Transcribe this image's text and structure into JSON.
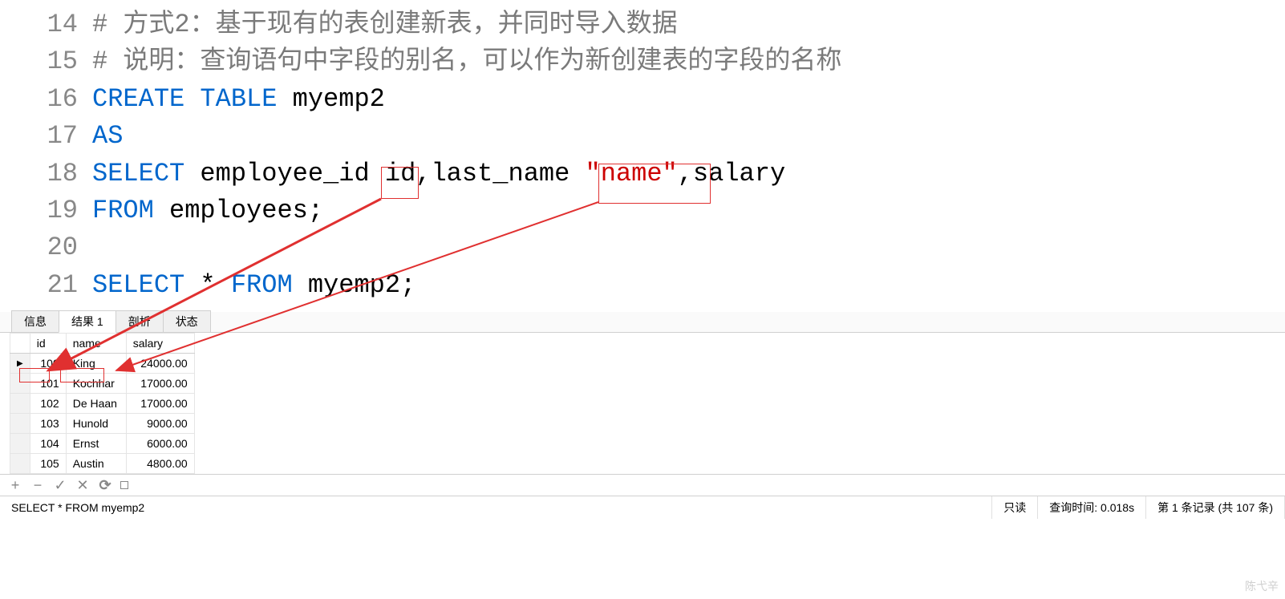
{
  "code": {
    "lines": [
      {
        "n": 14,
        "tokens": [
          {
            "t": "# 方式2：基于现有的表创建新表，并同时导入数据",
            "c": "cmt"
          }
        ]
      },
      {
        "n": 15,
        "tokens": [
          {
            "t": "# 说明：查询语句中字段的别名，可以作为新创建表的字段的名称",
            "c": "cmt"
          }
        ]
      },
      {
        "n": 16,
        "tokens": [
          {
            "t": "CREATE",
            "c": "kw"
          },
          {
            "t": " "
          },
          {
            "t": "TABLE",
            "c": "kw"
          },
          {
            "t": " myemp2"
          }
        ]
      },
      {
        "n": 17,
        "tokens": [
          {
            "t": "AS",
            "c": "kw"
          }
        ]
      },
      {
        "n": 18,
        "tokens": [
          {
            "t": "SELECT",
            "c": "kw"
          },
          {
            "t": " employee_id id,last_name "
          },
          {
            "t": "\"name\"",
            "c": "str"
          },
          {
            "t": ",salary"
          }
        ]
      },
      {
        "n": 19,
        "tokens": [
          {
            "t": "FROM",
            "c": "kw"
          },
          {
            "t": " employees;"
          }
        ]
      },
      {
        "n": 20,
        "tokens": [
          {
            "t": " "
          }
        ]
      },
      {
        "n": 21,
        "tokens": [
          {
            "t": "SELECT",
            "c": "kw"
          },
          {
            "t": " * "
          },
          {
            "t": "FROM",
            "c": "kw"
          },
          {
            "t": " myemp2;"
          }
        ]
      }
    ]
  },
  "tabs": {
    "items": [
      {
        "label": "信息",
        "active": false
      },
      {
        "label": "结果 1",
        "active": true
      },
      {
        "label": "剖析",
        "active": false
      },
      {
        "label": "状态",
        "active": false
      }
    ]
  },
  "grid": {
    "columns": [
      "id",
      "name",
      "salary"
    ],
    "rows": [
      {
        "selected": true,
        "cells": [
          "100",
          "King",
          "24000.00"
        ]
      },
      {
        "selected": false,
        "cells": [
          "101",
          "Kochhar",
          "17000.00"
        ]
      },
      {
        "selected": false,
        "cells": [
          "102",
          "De Haan",
          "17000.00"
        ]
      },
      {
        "selected": false,
        "cells": [
          "103",
          "Hunold",
          "9000.00"
        ]
      },
      {
        "selected": false,
        "cells": [
          "104",
          "Ernst",
          "6000.00"
        ]
      },
      {
        "selected": false,
        "cells": [
          "105",
          "Austin",
          "4800.00"
        ]
      }
    ]
  },
  "statusbar": {
    "sql": "SELECT * FROM myemp2",
    "readonly": "只读",
    "querytime": "查询时间: 0.018s",
    "record": "第 1 条记录 (共 107 条)"
  },
  "watermark": "陈弋辛",
  "toolbar": {
    "add": "+",
    "remove": "−",
    "apply": "✓",
    "cancel": "✕",
    "refresh": "⟳"
  }
}
